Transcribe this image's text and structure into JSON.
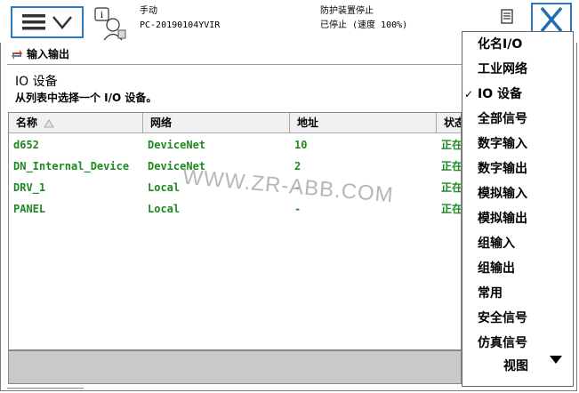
{
  "top": {
    "mode": "手动",
    "controller": "PC-20190104YVIR",
    "safety_status": "防护装置停止",
    "run_status": "已停止 (速度 100%)"
  },
  "breadcrumb": {
    "label": "输入输出"
  },
  "header": {
    "title": "IO 设备",
    "subtitle": "从列表中选择一个 I/O 设备。"
  },
  "table": {
    "columns": [
      "名称",
      "网络",
      "地址",
      "状态"
    ],
    "rows": [
      {
        "name": "d652",
        "network": "DeviceNet",
        "address": "10",
        "status": "正在运行"
      },
      {
        "name": "DN_Internal_Device",
        "network": "DeviceNet",
        "address": "2",
        "status": "正在运行"
      },
      {
        "name": "DRV_1",
        "network": "Local",
        "address": "-",
        "status": "正在运行"
      },
      {
        "name": "PANEL",
        "network": "Local",
        "address": "-",
        "status": "正在运行"
      }
    ]
  },
  "watermark": "WWW.ZR-ABB.COM",
  "menu": {
    "items": [
      {
        "label": "化名I/O",
        "checked": false
      },
      {
        "label": "工业网络",
        "checked": false
      },
      {
        "label": "IO 设备",
        "checked": true
      },
      {
        "label": "全部信号",
        "checked": false
      },
      {
        "label": "数字输入",
        "checked": false
      },
      {
        "label": "数字输出",
        "checked": false
      },
      {
        "label": "模拟输入",
        "checked": false
      },
      {
        "label": "模拟输出",
        "checked": false
      },
      {
        "label": "组输入",
        "checked": false
      },
      {
        "label": "组输出",
        "checked": false
      },
      {
        "label": "常用",
        "checked": false
      },
      {
        "label": "安全信号",
        "checked": false
      },
      {
        "label": "仿真信号",
        "checked": false
      }
    ],
    "check_mark": "✓",
    "view_label": "视图"
  },
  "colors": {
    "accent": "#2a78c8",
    "running_text": "#1e8a1e",
    "close_x": "#1f6fb8"
  }
}
